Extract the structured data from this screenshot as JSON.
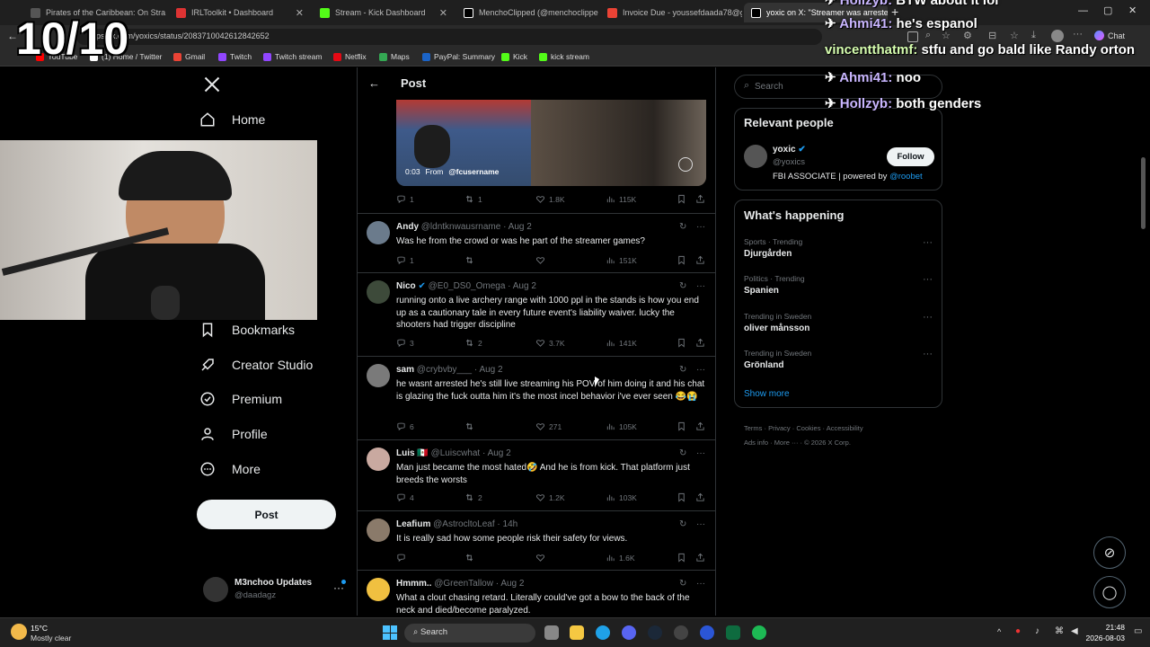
{
  "browser": {
    "tabs": [
      {
        "title": "Pirates of the Caribbean: On Stra",
        "color": "#555"
      },
      {
        "title": "IRLToolkit • Dashboard",
        "color": "#d33"
      },
      {
        "title": "Stream - Kick Dashboard",
        "color": "#53fc18"
      },
      {
        "title": "MenchoClipped (@menchoclipped",
        "color": "#fff"
      },
      {
        "title": "Invoice Due - youssefdaada78@g",
        "color": "#ea4335"
      },
      {
        "title": "yoxic on X: \"Streamer was arreste",
        "color": "#fff"
      }
    ],
    "url": "https://x.com/yoxics/status/2083710042612842652",
    "bookmarks": [
      "YouTube",
      "(1) Home / Twitter",
      "Gmail",
      "Twitch",
      "Twitch stream",
      "Netflix",
      "Maps",
      "PayPal: Summary",
      "Kick",
      "kick stream"
    ],
    "chat_button": "Chat"
  },
  "overlay": {
    "rating": "10/10",
    "chat": [
      {
        "user": "Hollzyb:",
        "msg": "BTW about it lol"
      },
      {
        "user": "Ahmi41:",
        "msg": "he's espanol"
      },
      {
        "user": "vincentthatmf:",
        "msg": "stfu and go bald like Randy orton"
      },
      {
        "user": "Ahmi41:",
        "msg": "noo"
      },
      {
        "user": "Hollzyb:",
        "msg": "both genders"
      }
    ]
  },
  "nav": {
    "items": [
      "Home",
      "Bookmarks",
      "Creator Studio",
      "Premium",
      "Profile",
      "More"
    ],
    "post_button": "Post",
    "account": {
      "name": "M3nchoo Updates",
      "handle": "@daadagz"
    }
  },
  "header": {
    "title": "Post"
  },
  "video": {
    "time": "0:03",
    "from_label": "From",
    "source": "@fcusername"
  },
  "main_stats": {
    "replies": "1",
    "reposts": "1",
    "likes": "1.8K",
    "views": "115K"
  },
  "tweets": [
    {
      "name": "Andy",
      "handle": "@ldntknwausrname",
      "date": "Aug 2",
      "text": "Was he from the crowd or was he part of the streamer games?",
      "replies": "1",
      "reposts": "",
      "likes": "",
      "views": "151K",
      "color": "#6b7b8c"
    },
    {
      "name": "Nico",
      "handle": "@E0_DS0_Omega",
      "date": "Aug 2",
      "text": "running onto a live archery range with 1000 ppl in the stands is how you end up as a cautionary tale in every future event's liability waiver. lucky the shooters had trigger discipline",
      "replies": "3",
      "reposts": "2",
      "likes": "3.7K",
      "views": "141K",
      "color": "#3d4a3a"
    },
    {
      "name": "sam",
      "handle": "@crybvby___",
      "date": "Aug 2",
      "text": "he wasnt arrested he's still live streaming his POV of him doing it and his chat is glazing the fuck outta him it's the most incel behavior i've ever seen 😂😭",
      "replies": "6",
      "reposts": "",
      "likes": "271",
      "views": "105K",
      "color": "#7a7a7a"
    },
    {
      "name": "Luis 🇲🇽",
      "handle": "@Luiscwhat",
      "date": "Aug 2",
      "text": "Man just became the most hated🤣 And he is from kick. That platform just breeds the worsts",
      "replies": "4",
      "reposts": "2",
      "likes": "1.2K",
      "views": "103K",
      "color": "#c9a9a0"
    },
    {
      "name": "Leafium",
      "handle": "@AstrocltoLeaf",
      "date": "14h",
      "text": "It is really sad how some people risk their safety for views.",
      "replies": "",
      "reposts": "",
      "likes": "",
      "views": "1.6K",
      "color": "#8a7a6a"
    },
    {
      "name": "Hmmm..",
      "handle": "@GreenTallow",
      "date": "Aug 2",
      "text": "What a clout chasing retard. Literally could've got a bow to the back of the neck and died/become paralyzed.",
      "replies": "",
      "reposts": "",
      "likes": "",
      "views": "",
      "color": "#f0c040"
    }
  ],
  "search": {
    "placeholder": "Search"
  },
  "relevant": {
    "title": "Relevant people",
    "name": "yoxic",
    "handle": "@yoxics",
    "bio": "FBI ASSOCIATE | powered by",
    "bio_link": "@roobet",
    "follow": "Follow"
  },
  "happening": {
    "title": "What's happening",
    "trends": [
      {
        "category": "Sports · Trending",
        "name": "Djurgården"
      },
      {
        "category": "Politics · Trending",
        "name": "Spanien"
      },
      {
        "category": "Trending in Sweden",
        "name": "oliver månsson"
      },
      {
        "category": "Trending in Sweden",
        "name": "Grönland"
      }
    ],
    "show_more": "Show more"
  },
  "footer": {
    "links": [
      "Terms",
      "Privacy",
      "Cookies",
      "Accessibility",
      "Ads info",
      "More ···",
      "© 2026 X Corp."
    ]
  },
  "taskbar": {
    "temp": "15°C",
    "weather": "Mostly clear",
    "search": "Search",
    "time": "21:48",
    "date": "2026-08-03"
  }
}
